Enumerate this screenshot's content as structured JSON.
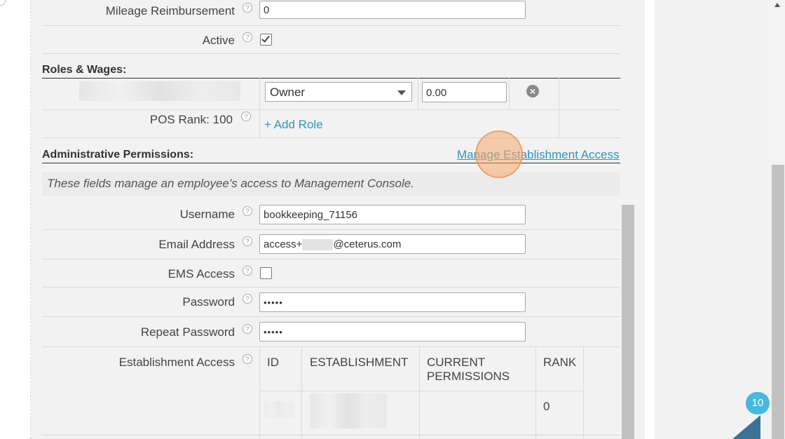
{
  "mileage": {
    "label": "Mileage Reimbursement",
    "value": "0"
  },
  "active": {
    "label": "Active",
    "checked": true
  },
  "roles": {
    "section_title": "Roles & Wages:",
    "role_select_value": "Owner",
    "wage_value": "0.00",
    "remove_icon": "close-circle-icon",
    "pos_rank_label": "POS Rank: 100",
    "add_role_label": "+ Add Role"
  },
  "admin": {
    "section_title": "Administrative Permissions:",
    "manage_link": "Manage Establishment Access",
    "note": "These fields manage an employee's access to Management Console.",
    "username": {
      "label": "Username",
      "value": "bookkeeping_71156"
    },
    "email": {
      "label": "Email Address",
      "value_prefix": "access+",
      "value_suffix": "@ceterus.com"
    },
    "ems": {
      "label": "EMS Access",
      "checked": false
    },
    "password": {
      "label": "Password",
      "value": "•••••"
    },
    "repeat_password": {
      "label": "Repeat Password",
      "value": "•••••"
    },
    "establishment": {
      "label": "Establishment Access",
      "columns": [
        "ID",
        "ESTABLISHMENT",
        "CURRENT PERMISSIONS",
        "RANK"
      ],
      "rows": [
        {
          "rank": "0"
        }
      ]
    }
  },
  "help_glyph": "?",
  "notification_badge": "10",
  "colors": {
    "link": "#2f94bf",
    "badge": "#46b9e0",
    "click_ring": "#f7aa6e"
  }
}
